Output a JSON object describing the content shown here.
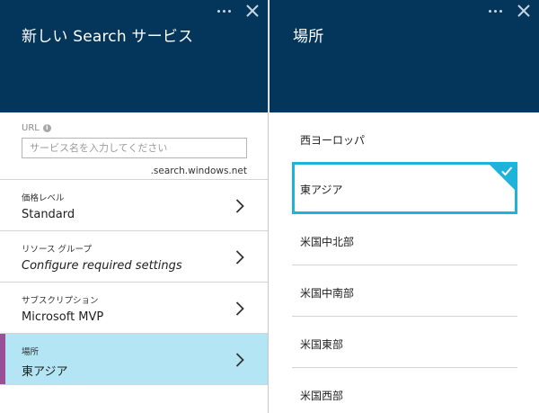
{
  "left_blade": {
    "title": "新しい Search サービス",
    "url": {
      "label": "URL",
      "placeholder": "サービス名を入力してください",
      "value": "",
      "suffix": ".search.windows.net"
    },
    "rows": [
      {
        "label": "価格レベル",
        "value": "Standard"
      },
      {
        "label": "リソース グループ",
        "value": "Configure required settings"
      },
      {
        "label": "サブスクリプション",
        "value": "Microsoft MVP"
      },
      {
        "label": "場所",
        "value": "東アジア"
      }
    ]
  },
  "right_blade": {
    "title": "場所",
    "locations": [
      "西ヨーロッパ",
      "東アジア",
      "米国中北部",
      "米国中南部",
      "米国東部",
      "米国西部"
    ],
    "selected_location": "東アジア"
  },
  "colors": {
    "header": "#04365c",
    "selected_row": "#b3e5f5",
    "row_marker": "#9b4f96",
    "selected_border": "#1fb3dc"
  },
  "icons": {
    "more": "ellipsis-icon",
    "close": "close-icon",
    "info": "info-icon",
    "chevron": "chevron-right-icon",
    "check": "checkmark-icon"
  }
}
